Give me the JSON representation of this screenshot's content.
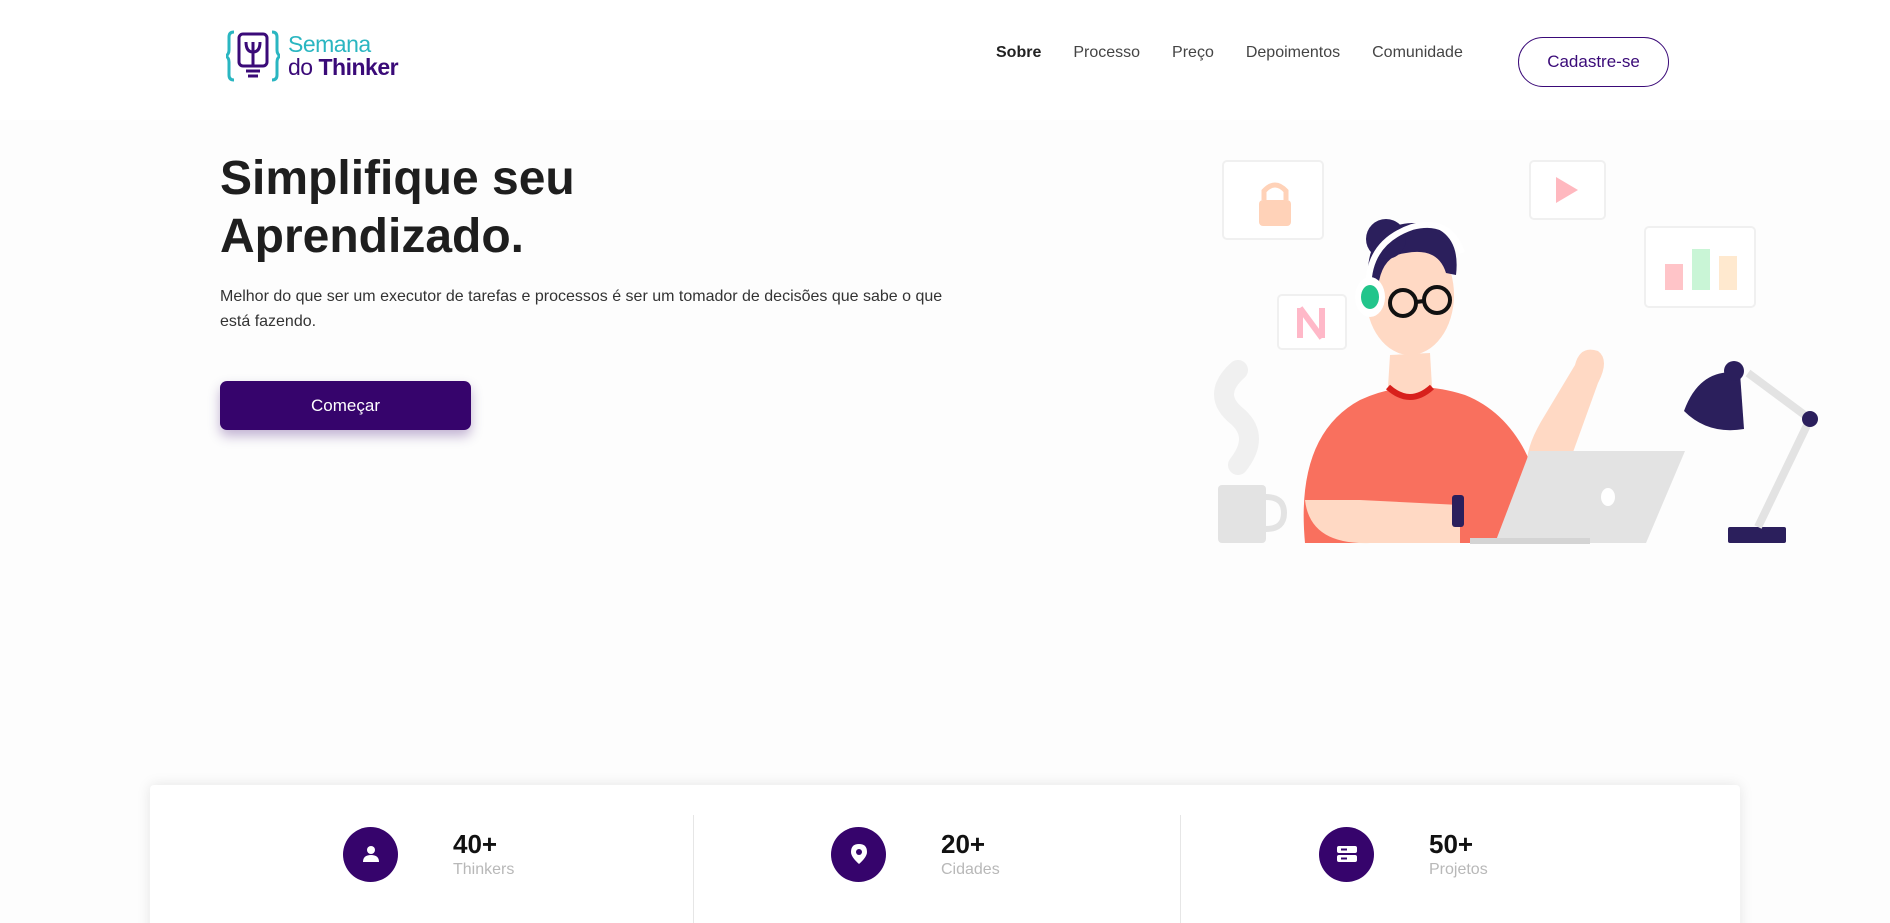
{
  "brand": {
    "line1": "Semana",
    "line2_prefix": "do ",
    "line2_bold": "Thinker",
    "primary_color": "#36046c",
    "accent_color": "#2ab6c1"
  },
  "nav": {
    "items": [
      {
        "label": "Sobre",
        "active": true
      },
      {
        "label": "Processo"
      },
      {
        "label": "Preço"
      },
      {
        "label": "Depoimentos"
      },
      {
        "label": "Comunidade"
      }
    ],
    "signup_label": "Cadastre-se"
  },
  "hero": {
    "title_line1": "Simplifique seu",
    "title_line2": "Aprendizado.",
    "subtitle": "Melhor do que ser um executor de tarefas e processos é ser um tomador de decisões que sabe o que está fazendo.",
    "cta_label": "Começar",
    "illustration_icons": [
      "lock-icon",
      "play-icon",
      "netflix-icon",
      "bar-chart-icon",
      "coffee-mug",
      "desk-lamp",
      "laptop"
    ]
  },
  "stats": [
    {
      "value": "40+",
      "label": "Thinkers",
      "icon": "user-icon"
    },
    {
      "value": "20+",
      "label": "Cidades",
      "icon": "location-pin-icon"
    },
    {
      "value": "50+",
      "label": "Projetos",
      "icon": "server-icon"
    }
  ]
}
